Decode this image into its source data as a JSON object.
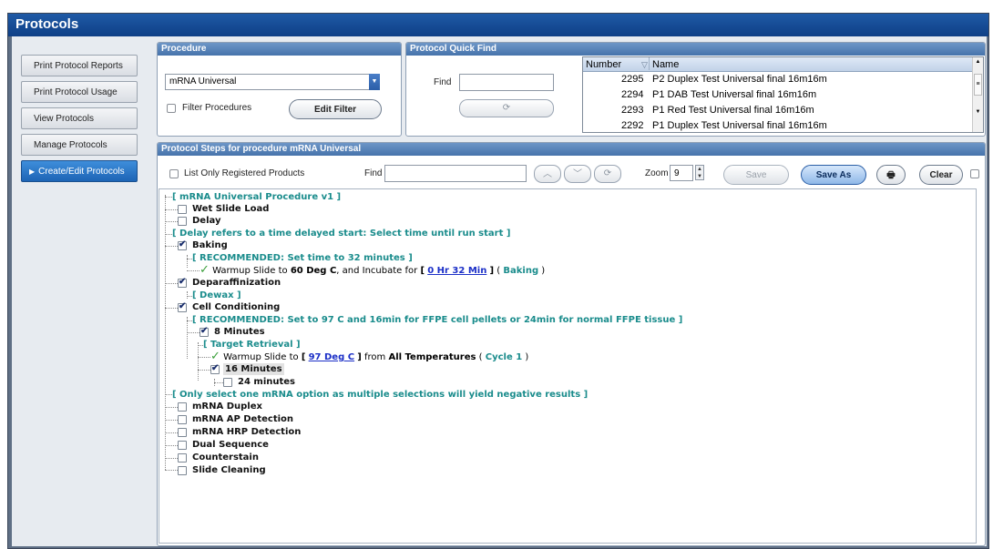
{
  "window": {
    "title": "Protocols"
  },
  "sidebar": {
    "items": [
      {
        "label": "Print Protocol Reports"
      },
      {
        "label": "Print Protocol Usage"
      },
      {
        "label": "View Protocols"
      },
      {
        "label": "Manage Protocols"
      },
      {
        "label": "Create/Edit Protocols",
        "active": true
      }
    ]
  },
  "procedure": {
    "header": "Procedure",
    "selected": "mRNA Universal",
    "filter_label": "Filter Procedures",
    "edit_filter_label": "Edit Filter"
  },
  "quick_find": {
    "header": "Protocol Quick Find",
    "find_label": "Find",
    "find_value": "",
    "columns": {
      "number": "Number",
      "name": "Name"
    },
    "rows": [
      {
        "number": "2295",
        "name": "P2 Duplex Test Universal final 16m16m"
      },
      {
        "number": "2294",
        "name": "P1 DAB Test Universal final 16m16m"
      },
      {
        "number": "2293",
        "name": "P1 Red Test Universal final 16m16m"
      },
      {
        "number": "2292",
        "name": "P1 Duplex Test Universal final 16m16m"
      }
    ]
  },
  "steps": {
    "header": "Protocol Steps for procedure mRNA Universal",
    "list_only_label": "List Only Registered Products",
    "find_label": "Find",
    "find_value": "",
    "zoom_label": "Zoom",
    "zoom_value": "9",
    "save_label": "Save",
    "save_as_label": "Save As",
    "clear_label": "Clear"
  },
  "tree": {
    "root": "[ mRNA Universal Procedure v1 ]",
    "wet_slide_load": "Wet Slide Load",
    "delay": "Delay",
    "delay_note": "[ Delay refers to a time delayed start: Select time until run start ]",
    "baking": "Baking",
    "baking_rec": "[ RECOMMENDED: Set time to 32 minutes ]",
    "baking_step": {
      "prefix": "Warmup Slide to",
      "temp": "60 Deg C",
      "mid": ", and Incubate for",
      "open": "[",
      "time": "0 Hr 32 Min",
      "close": "]",
      "ctx_open": "(",
      "ctx": "Baking",
      "ctx_close": ")"
    },
    "deparaffinization": "Deparaffinization",
    "dewax": "[ Dewax ]",
    "cell_conditioning": "Cell Conditioning",
    "cc_rec": "[ RECOMMENDED: Set to 97 C and 16min for FFPE cell pellets or 24min for normal FFPE tissue ]",
    "eight_min": "8 Minutes",
    "target_retrieval": "[ Target Retrieval ]",
    "cc_step": {
      "prefix": "Warmup Slide to",
      "open": "[",
      "temp": "97 Deg C",
      "close": "]",
      "mid": "from",
      "range": "All Temperatures",
      "ctx_open": "(",
      "ctx": "Cycle 1",
      "ctx_close": ")"
    },
    "sixteen_min": "16 Minutes",
    "twentyfour_min": "24 minutes",
    "mrna_note": "[ Only select one mRNA option as multiple selections will yield negative results ]",
    "mrna_duplex": "mRNA Duplex",
    "mrna_ap": "mRNA AP Detection",
    "mrna_hrp": "mRNA HRP Detection",
    "dual_sequence": "Dual Sequence",
    "counterstain": "Counterstain",
    "slide_cleaning": "Slide Cleaning"
  }
}
